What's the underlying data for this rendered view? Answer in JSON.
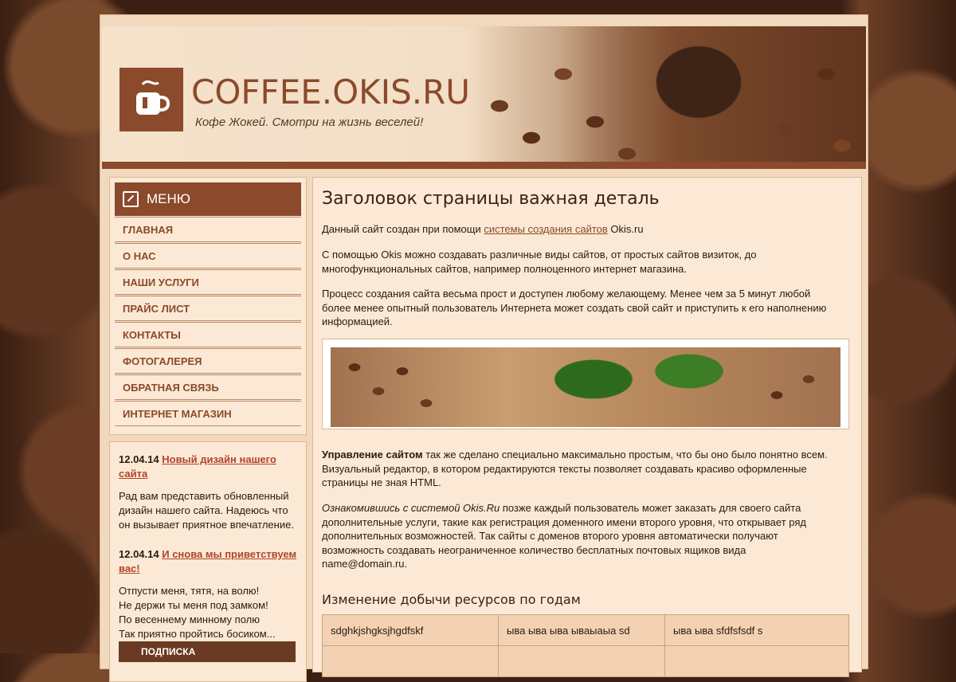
{
  "header": {
    "site_title": "COFFEE.OKIS.RU",
    "tagline": "Кофе Жокей. Смотри на жизнь веселей!",
    "logo_icon": "coffee-cup-icon"
  },
  "menu": {
    "title": "МЕНЮ",
    "items": [
      {
        "label": "ГЛАВНАЯ"
      },
      {
        "label": "О НАС"
      },
      {
        "label": "НАШИ УСЛУГИ"
      },
      {
        "label": "ПРАЙС ЛИСТ"
      },
      {
        "label": "КОНТАКТЫ"
      },
      {
        "label": "ФОТОГАЛЕРЕЯ"
      },
      {
        "label": "ОБРАТНАЯ СВЯЗЬ"
      },
      {
        "label": "ИНТЕРНЕТ МАГАЗИН"
      }
    ]
  },
  "news": [
    {
      "date": "12.04.14",
      "title": "Новый дизайн нашего сайта",
      "text": "Рад вам представить обновленный дизайн нашего сайта. Надеюсь что он вызывает приятное впечатление."
    },
    {
      "date": "12.04.14",
      "title": "И снова мы приветствуем вас!",
      "lines": [
        "Отпусти меня, тятя, на волю!",
        "Не держи ты меня под замком!",
        "По весеннему минному полю",
        "Так приятно пройтись босиком..."
      ]
    }
  ],
  "subscribe_label": "ПОДПИСКА",
  "content": {
    "title": "Заголовок страницы важная деталь",
    "p1_before": "Данный сайт создан при помощи ",
    "p1_link": "системы создания сайтов",
    "p1_after": " Okis.ru",
    "p2": "С помощью Okis можно создавать различные виды сайтов, от простых сайтов визиток, до многофункциональных сайтов, например полноценного интернет магазина.",
    "p3": "Процесс создания сайта весьма прост и доступен любому желающему. Менее чем за 5 минут любой более менее опытный пользователь Интернета может создать свой сайт и приступить к его наполнению информацией.",
    "p4_bold": "Управление сайтом",
    "p4_rest": " так же сделано специально максимально простым, что бы оно было понятно всем. Визуальный редактор, в котором редактируются тексты позволяет создавать красиво оформленные страницы не зная HTML.",
    "p5_italic": "Ознакомившись с системой Okis.Ru",
    "p5_rest": " позже каждый пользователь может заказать для своего сайта дополнительные услуги, такие как регистрация доменного имени второго уровня, что открывает ряд дополнительных возможностей. Так сайты с доменов второго уровня автоматически получают возможность создавать неограниченное количество бесплатных почтовых ящиков вида name@domain.ru.",
    "subtitle": "Изменение добычи ресурсов по годам",
    "table_row": [
      "sdghkjshgksjhgdfskf",
      "ыва ыва ыва ываыаыа sd",
      "ыва ыва sfdfsfsdf s"
    ]
  }
}
